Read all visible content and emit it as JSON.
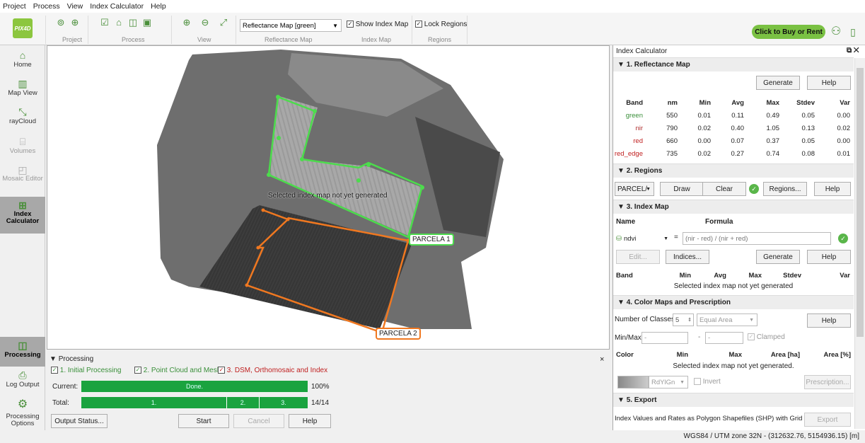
{
  "menu": [
    "Project",
    "Process",
    "View",
    "Index Calculator",
    "Help"
  ],
  "ribbon": {
    "logo": "PIX4D",
    "groups": [
      "Project",
      "Process",
      "View",
      "Reflectance Map",
      "Index Map",
      "Regions"
    ],
    "reflectance_select": "Reflectance Map [green]",
    "show_index_map": "Show Index Map",
    "lock_regions": "Lock Regions",
    "buy": "Click to Buy or Rent"
  },
  "nav": [
    "Home",
    "Map View",
    "rayCloud",
    "Volumes",
    "Mosaic Editor",
    "Index Calculator",
    "Processing",
    "Log Output",
    "Processing Options"
  ],
  "viewport": {
    "message": "Selected index map not yet generated",
    "parcela1": "PARCELA 1",
    "parcela2": "PARCELA 2"
  },
  "processing": {
    "title": "Processing",
    "steps": [
      "1. Initial Processing",
      "2. Point Cloud and Mesh",
      "3. DSM, Orthomosaic and Index"
    ],
    "current_label": "Current:",
    "current_text": "Done.",
    "current_pct": "100%",
    "total_label": "Total:",
    "total_steps": [
      "1.",
      "2.",
      "3."
    ],
    "total_count": "14/14",
    "buttons": [
      "Output Status...",
      "Start",
      "Cancel",
      "Help"
    ]
  },
  "panel": {
    "title": "Index Calculator",
    "s1": {
      "title": "1. Reflectance Map",
      "generate": "Generate",
      "help": "Help",
      "headers": [
        "Band",
        "nm",
        "Min",
        "Avg",
        "Max",
        "Stdev",
        "Var"
      ],
      "rows": [
        [
          "green",
          "550",
          "0.01",
          "0.11",
          "0.49",
          "0.05",
          "0.00"
        ],
        [
          "nir",
          "790",
          "0.02",
          "0.40",
          "1.05",
          "0.13",
          "0.02"
        ],
        [
          "red",
          "660",
          "0.00",
          "0.07",
          "0.37",
          "0.05",
          "0.00"
        ],
        [
          "red_edge",
          "735",
          "0.02",
          "0.27",
          "0.74",
          "0.08",
          "0.01"
        ]
      ],
      "colors": [
        "#3a8f3a",
        "#b03030",
        "#c02020",
        "#c02020"
      ]
    },
    "s2": {
      "title": "2. Regions",
      "select": "PARCEL/",
      "draw": "Draw",
      "clear": "Clear",
      "regions": "Regions...",
      "help": "Help"
    },
    "s3": {
      "title": "3. Index Map",
      "name_h": "Name",
      "formula_h": "Formula",
      "name": "ndvi",
      "formula": "(nir - red) / (nir + red)",
      "edit": "Edit...",
      "indices": "Indices...",
      "generate": "Generate",
      "help": "Help",
      "headers": [
        "Band",
        "Min",
        "Avg",
        "Max",
        "Stdev",
        "Var"
      ],
      "msg": "Selected index map not yet generated"
    },
    "s4": {
      "title": "4. Color Maps and Prescription",
      "classes_label": "Number of Classes",
      "classes": "5",
      "method": "Equal Area",
      "help": "Help",
      "minmax": "Min/Max",
      "clamped": "Clamped",
      "headers": [
        "Color",
        "Min",
        "Max",
        "Area [ha]",
        "Area [%]"
      ],
      "msg": "Selected index map not yet generated.",
      "colormap": "RdYlGn",
      "invert": "Invert",
      "prescription": "Prescription..."
    },
    "s5": {
      "title": "5. Export",
      "text": "Index Values and Rates as Polygon Shapefiles (SHP) with Grid",
      "export": "Export"
    }
  },
  "status": "WGS84 / UTM zone 32N - (312632.76, 5154936.15) [m]"
}
